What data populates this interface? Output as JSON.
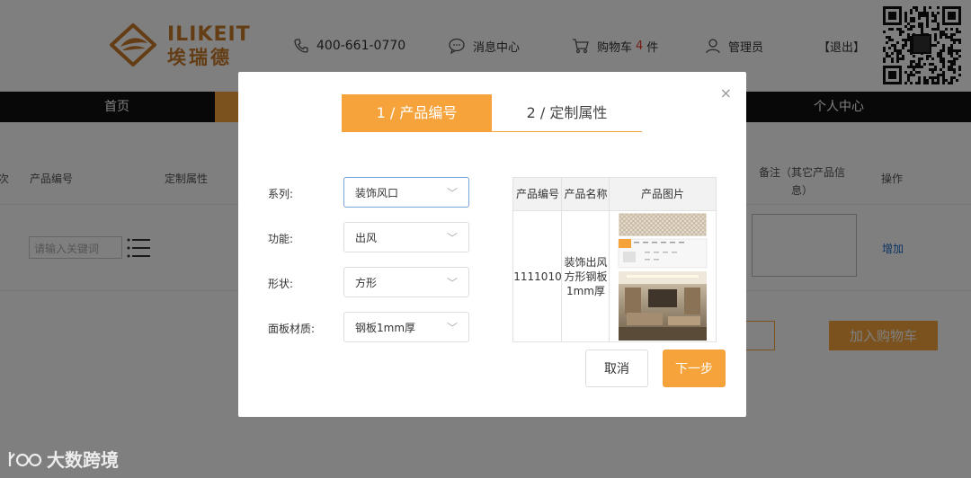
{
  "header": {
    "logo_en": "ILIKEIT",
    "logo_cn": "埃瑞德",
    "phone": "400-661-0770",
    "message_center": "消息中心",
    "cart_label": "购物车",
    "cart_count": "4",
    "cart_unit": "件",
    "user": "管理员",
    "logout": "【退出】"
  },
  "nav": {
    "home": "首页",
    "personal": "个人中心"
  },
  "table": {
    "headers": {
      "seq": "项次",
      "code": "产品编号",
      "attr": "定制属性",
      "remark": "备注（其它产品信息）",
      "op": "操作"
    },
    "row": {
      "keyword_placeholder": "请输入关键词",
      "add_link": "增加"
    },
    "add_to_cart": "加入购物车"
  },
  "modal": {
    "steps": [
      "1 / 产品编号",
      "2 / 定制属性"
    ],
    "active_step": 0,
    "close_glyph": "×",
    "form": [
      {
        "label": "系列:",
        "value": "装饰风口"
      },
      {
        "label": "功能:",
        "value": "出风"
      },
      {
        "label": "形状:",
        "value": "方形"
      },
      {
        "label": "面板材质:",
        "value": "钢板1mm厚"
      }
    ],
    "product_table": {
      "headers": [
        "产品编号",
        "产品名称",
        "产品图片"
      ],
      "row": {
        "code": "1111010",
        "name": "装饰出风方形钢板1mm厚"
      }
    },
    "cancel": "取消",
    "next": "下一步"
  },
  "watermark": "大数跨境",
  "colors": {
    "accent": "#f6a33b",
    "nav_bg": "#111111",
    "cart_count": "#e4392b",
    "link": "#1a67c8",
    "overlay": "rgba(0,0,0,0.5)"
  }
}
